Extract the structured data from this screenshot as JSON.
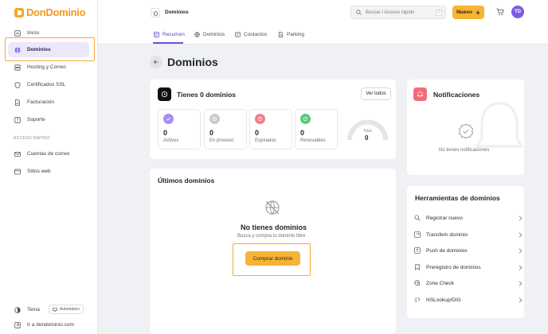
{
  "brand": {
    "name": "DonDominio"
  },
  "sidebar": {
    "items": [
      {
        "label": "Inicio"
      },
      {
        "label": "Dominios"
      },
      {
        "label": "Hosting y Correo"
      },
      {
        "label": "Certificados SSL"
      },
      {
        "label": "Facturación"
      },
      {
        "label": "Soporte"
      }
    ],
    "quick_title": "ACCESO RÁPIDO",
    "quick_items": [
      {
        "label": "Cuentas de correo"
      },
      {
        "label": "Sitios web"
      }
    ],
    "theme_label": "Tema",
    "theme_value": "Automático",
    "site_link": "Ir a dondominio.com"
  },
  "topbar": {
    "breadcrumb": "Dominios",
    "search_placeholder": "Buscar / Acceso rápido",
    "search_shortcut": "/",
    "new_button": "Nuevo",
    "avatar": "TD"
  },
  "tabs": [
    {
      "label": "Resumen"
    },
    {
      "label": "Dominios"
    },
    {
      "label": "Contactos"
    },
    {
      "label": "Parking"
    }
  ],
  "page": {
    "title": "Dominios"
  },
  "summary": {
    "title": "Tienes 0 dominios",
    "view_all": "Ver todos",
    "stats": [
      {
        "value": "0",
        "label": "Activos",
        "color": "#a98cf4"
      },
      {
        "value": "0",
        "label": "En proceso",
        "color": "#c9cbd1"
      },
      {
        "value": "0",
        "label": "Expirados",
        "color": "#f27d87"
      },
      {
        "value": "0",
        "label": "Renovables",
        "color": "#5cc97a"
      }
    ],
    "total_label": "Total",
    "total_value": "0"
  },
  "recent": {
    "title": "Últimos dominios",
    "empty_title": "No tienes dominios",
    "empty_sub": "Busca y compra tu dominio libre",
    "buy_button": "Comprar dominio"
  },
  "notifications": {
    "title": "Notificaciones",
    "empty": "No tienes notificaciones"
  },
  "tools": {
    "title": "Herramientas de dominios",
    "items": [
      {
        "label": "Registrar nuevo"
      },
      {
        "label": "Transferir dominio"
      },
      {
        "label": "Push de dominios"
      },
      {
        "label": "Preregistro de dominios"
      },
      {
        "label": "Zone Check"
      },
      {
        "label": "NSLookup/DIG"
      }
    ]
  },
  "colors": {
    "accent": "#6d52de",
    "brand": "#f49a1e",
    "button": "#f6b436"
  }
}
